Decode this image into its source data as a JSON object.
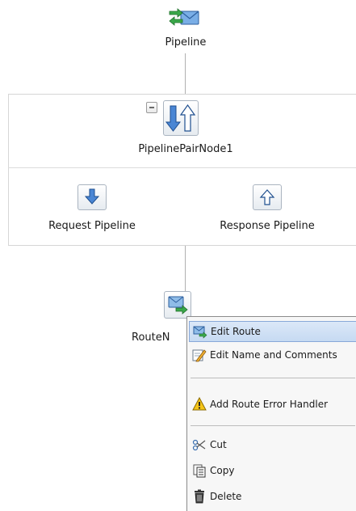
{
  "pipeline": {
    "label": "Pipeline",
    "icon": "pipeline-envelope-icon"
  },
  "pipeline_pair": {
    "label": "PipelinePairNode1",
    "icon": "pipeline-pair-icon",
    "request": {
      "label": "Request Pipeline",
      "icon": "down-arrow-icon"
    },
    "response": {
      "label": "Response Pipeline",
      "icon": "up-arrow-icon"
    }
  },
  "route_node": {
    "label": "RouteN",
    "icon": "route-envelope-icon"
  },
  "context_menu": {
    "items": [
      {
        "label": "Edit Route",
        "icon": "edit-route-icon",
        "selected": true
      },
      {
        "label": "Edit Name and Comments",
        "icon": "pencil-edit-icon"
      },
      {
        "label": "Add Route Error Handler",
        "icon": "warning-icon"
      },
      {
        "label": "Cut",
        "icon": "scissors-icon"
      },
      {
        "label": "Copy",
        "icon": "copy-icon"
      },
      {
        "label": "Delete",
        "icon": "trash-icon"
      }
    ]
  },
  "colors": {
    "arrow_blue": "#3a78c8",
    "arrow_green": "#3aa84a",
    "menu_selected": "#c6daf2",
    "connector": "#b0b0b0"
  }
}
